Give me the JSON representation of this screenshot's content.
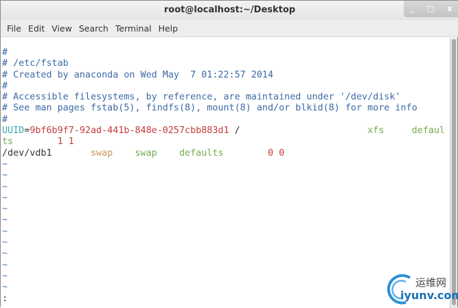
{
  "window": {
    "title": "root@localhost:~/Desktop",
    "buttons": [
      "_",
      "□",
      "x"
    ]
  },
  "menu": [
    "File",
    "Edit",
    "View",
    "Search",
    "Terminal",
    "Help"
  ],
  "lines": {
    "l1": "#",
    "l2": "# /etc/fstab",
    "l3": "# Created by anaconda on Wed May  7 01:22:57 2014",
    "l4": "#",
    "l5": "# Accessible filesystems, by reference, are maintained under '/dev/disk'",
    "l6": "# See man pages fstab(5), findfs(8), mount(8) and/or blkid(8) for more info",
    "l7": "#"
  },
  "uuid": {
    "key": "UUID",
    "eq": "=",
    "value": "9bf6b9f7-92ad-441b-848e-0257cbb883d1",
    "mount": " /",
    "pad": "                       ",
    "fs": "xfs",
    "pad2": "     ",
    "opts1": "defaul",
    "opts2": "ts",
    "pad3": "        ",
    "nums": "1 1"
  },
  "swapline": {
    "dev": "/dev/vdb1",
    "pad1": "       ",
    "mount": "swap",
    "pad2": "    ",
    "type": "swap",
    "pad3": "    ",
    "opts": "defaults",
    "pad4": "        ",
    "nums": "0 0"
  },
  "tilde": "~",
  "cmdline": ":",
  "watermark": {
    "cn": "运维网",
    "en": "iyunv.com"
  }
}
